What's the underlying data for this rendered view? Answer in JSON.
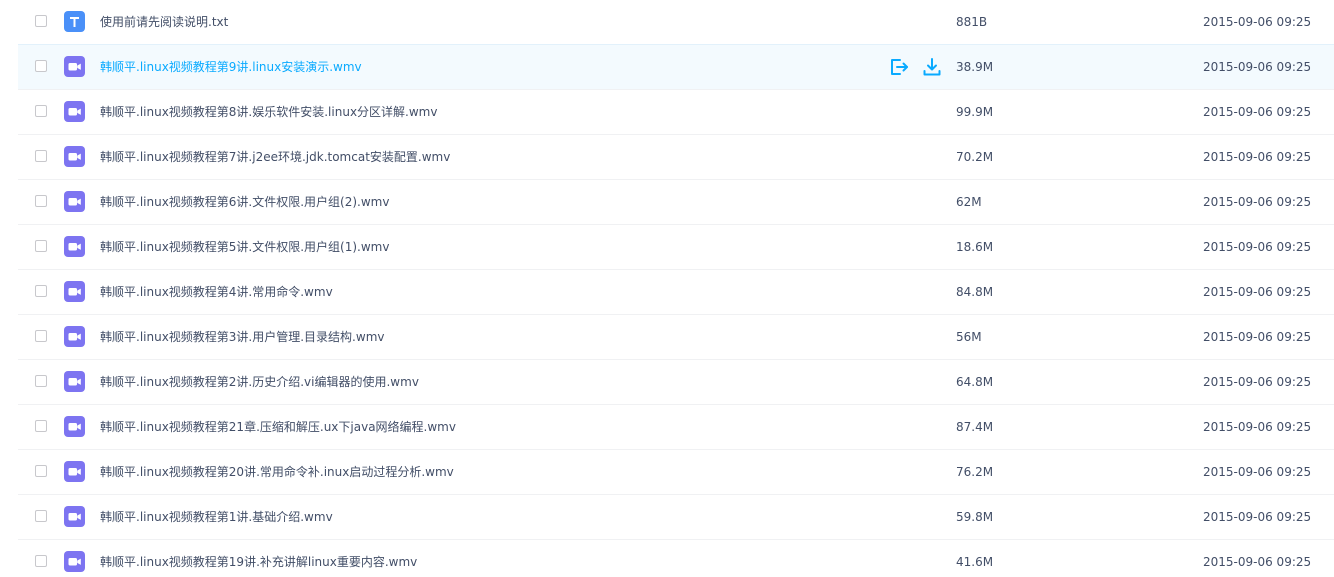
{
  "files": [
    {
      "name": "使用前请先阅读说明.txt",
      "size": "881B",
      "date": "2015-09-06 09:25",
      "type": "txt",
      "icon": "text-file-icon",
      "hover": false
    },
    {
      "name": "韩顺平.linux视频教程第9讲.linux安装演示.wmv",
      "size": "38.9M",
      "date": "2015-09-06 09:25",
      "type": "video",
      "icon": "video-file-icon",
      "hover": true
    },
    {
      "name": "韩顺平.linux视频教程第8讲.娱乐软件安装.linux分区详解.wmv",
      "size": "99.9M",
      "date": "2015-09-06 09:25",
      "type": "video",
      "icon": "video-file-icon",
      "hover": false
    },
    {
      "name": "韩顺平.linux视频教程第7讲.j2ee环境.jdk.tomcat安装配置.wmv",
      "size": "70.2M",
      "date": "2015-09-06 09:25",
      "type": "video",
      "icon": "video-file-icon",
      "hover": false
    },
    {
      "name": "韩顺平.linux视频教程第6讲.文件权限.用户组(2).wmv",
      "size": "62M",
      "date": "2015-09-06 09:25",
      "type": "video",
      "icon": "video-file-icon",
      "hover": false
    },
    {
      "name": "韩顺平.linux视频教程第5讲.文件权限.用户组(1).wmv",
      "size": "18.6M",
      "date": "2015-09-06 09:25",
      "type": "video",
      "icon": "video-file-icon",
      "hover": false
    },
    {
      "name": "韩顺平.linux视频教程第4讲.常用命令.wmv",
      "size": "84.8M",
      "date": "2015-09-06 09:25",
      "type": "video",
      "icon": "video-file-icon",
      "hover": false
    },
    {
      "name": "韩顺平.linux视频教程第3讲.用户管理.目录结构.wmv",
      "size": "56M",
      "date": "2015-09-06 09:25",
      "type": "video",
      "icon": "video-file-icon",
      "hover": false
    },
    {
      "name": "韩顺平.linux视频教程第2讲.历史介绍.vi编辑器的使用.wmv",
      "size": "64.8M",
      "date": "2015-09-06 09:25",
      "type": "video",
      "icon": "video-file-icon",
      "hover": false
    },
    {
      "name": "韩顺平.linux视频教程第21章.压缩和解压.ux下java网络编程.wmv",
      "size": "87.4M",
      "date": "2015-09-06 09:25",
      "type": "video",
      "icon": "video-file-icon",
      "hover": false
    },
    {
      "name": "韩顺平.linux视频教程第20讲.常用命令补.inux启动过程分析.wmv",
      "size": "76.2M",
      "date": "2015-09-06 09:25",
      "type": "video",
      "icon": "video-file-icon",
      "hover": false
    },
    {
      "name": "韩顺平.linux视频教程第1讲.基础介绍.wmv",
      "size": "59.8M",
      "date": "2015-09-06 09:25",
      "type": "video",
      "icon": "video-file-icon",
      "hover": false
    },
    {
      "name": "韩顺平.linux视频教程第19讲.补充讲解linux重要内容.wmv",
      "size": "41.6M",
      "date": "2015-09-06 09:25",
      "type": "video",
      "icon": "video-file-icon",
      "hover": false
    }
  ],
  "row_actions": [
    {
      "icon": "share-icon"
    },
    {
      "icon": "download-icon"
    }
  ],
  "colors": {
    "accent": "#09aaff",
    "text": "#424e67",
    "video_icon": "#7d74f1",
    "txt_icon": "#4a90f8",
    "hover_bg": "#f3fafe"
  }
}
